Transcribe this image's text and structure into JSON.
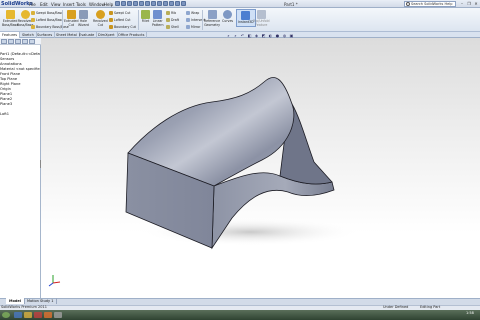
{
  "app": {
    "logo": "SolidWorks",
    "document_title": "Part1 *"
  },
  "menu": [
    "File",
    "Edit",
    "View",
    "Insert",
    "Tools",
    "Window",
    "Help"
  ],
  "search": {
    "placeholder": "Search SolidWorks Help"
  },
  "window_controls": {
    "minimize": "–",
    "restore": "❐",
    "close": "✕"
  },
  "ribbon": {
    "big_left": [
      {
        "label": "Extruded\nBoss/Base",
        "color": "#e6b830"
      },
      {
        "label": "Revolved\nBoss/Base",
        "color": "#e6b830"
      }
    ],
    "small_left": [
      "Swept Boss/Base",
      "Lofted Boss/Base",
      "Boundary Boss/Base"
    ],
    "big_mid": [
      {
        "label": "Extruded\nCut",
        "color": "#d8a020"
      },
      {
        "label": "Hole\nWizard",
        "color": "#8a9bb8"
      },
      {
        "label": "Revolved\nCut",
        "color": "#d8a020"
      }
    ],
    "small_mid": [
      "Swept Cut",
      "Lofted Cut",
      "Boundary Cut"
    ],
    "big_fillet": [
      {
        "label": "Fillet",
        "color": "#9ab64a"
      },
      {
        "label": "Linear\nPattern",
        "color": "#6f8fcf"
      }
    ],
    "small_right1": [
      "Rib",
      "Draft",
      "Shell"
    ],
    "small_right2": [
      "Wrap",
      "Intersect",
      "Mirror"
    ],
    "big_right": [
      {
        "label": "Reference\nGeometry",
        "color": "#8aa0c6"
      },
      {
        "label": "Curves",
        "color": "#7e98c4"
      },
      {
        "label": "Instant3D",
        "color": "#4c7fd1"
      },
      {
        "label": "Rip/Unfold\nFeature",
        "color": "#b5bfcf"
      }
    ]
  },
  "tabs": [
    "Features",
    "Sketch",
    "Surfaces",
    "Sheet Metal",
    "Evaluate",
    "DimXpert",
    "Office Products"
  ],
  "active_tab": "Features",
  "feature_tree": [
    "Part1 (Default<<Default>_Dis",
    "Sensors",
    "Annotations",
    "Material <not specified>",
    "Front Plane",
    "Top Plane",
    "Right Plane",
    "Origin",
    "Plane1",
    "Plane2",
    "Plane3",
    "Loft1"
  ],
  "view_tabs": [
    "Model",
    "Motion Study 1"
  ],
  "active_view_tab": "Model",
  "status": {
    "left": "SolidWorks Premium 2011",
    "mid": "Under Defined",
    "right": "Editing Part"
  },
  "taskbar": {
    "time": "1:58"
  },
  "model": {
    "face_color": "#8a90a2",
    "edge_color": "#1c1c24"
  }
}
